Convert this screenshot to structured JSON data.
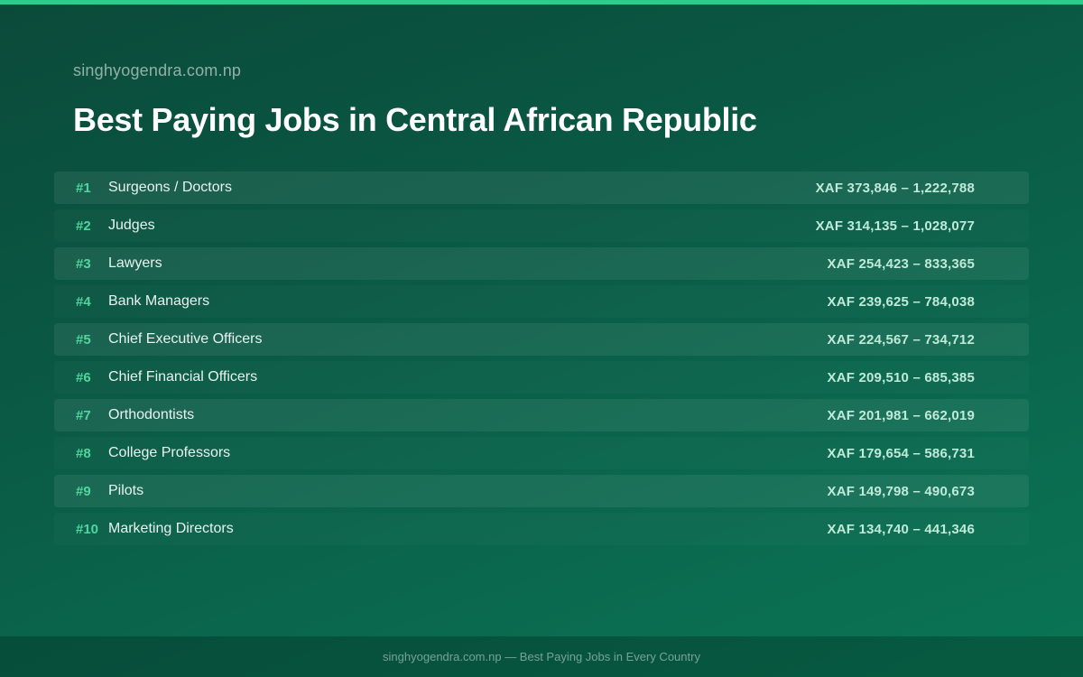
{
  "header": {
    "site": "singhyogendra.com.np",
    "title": "Best Paying Jobs in Central African Republic"
  },
  "jobs": [
    {
      "rank": "#1",
      "name": "Surgeons / Doctors",
      "salary": "XAF 373,846 – 1,222,788"
    },
    {
      "rank": "#2",
      "name": "Judges",
      "salary": "XAF 314,135 – 1,028,077"
    },
    {
      "rank": "#3",
      "name": "Lawyers",
      "salary": "XAF 254,423 – 833,365"
    },
    {
      "rank": "#4",
      "name": "Bank Managers",
      "salary": "XAF 239,625 – 784,038"
    },
    {
      "rank": "#5",
      "name": "Chief Executive Officers",
      "salary": "XAF 224,567 – 734,712"
    },
    {
      "rank": "#6",
      "name": "Chief Financial Officers",
      "salary": "XAF 209,510 – 685,385"
    },
    {
      "rank": "#7",
      "name": "Orthodontists",
      "salary": "XAF 201,981 – 662,019"
    },
    {
      "rank": "#8",
      "name": "College Professors",
      "salary": "XAF 179,654 – 586,731"
    },
    {
      "rank": "#9",
      "name": "Pilots",
      "salary": "XAF 149,798 – 490,673"
    },
    {
      "rank": "#10",
      "name": "Marketing Directors",
      "salary": "XAF 134,740 – 441,346"
    }
  ],
  "footer": {
    "text": "singhyogendra.com.np — Best Paying Jobs in Every Country"
  },
  "colors": {
    "accent": "#2ecc8a",
    "rank": "#4fd69c",
    "background": "#0a5a45"
  }
}
